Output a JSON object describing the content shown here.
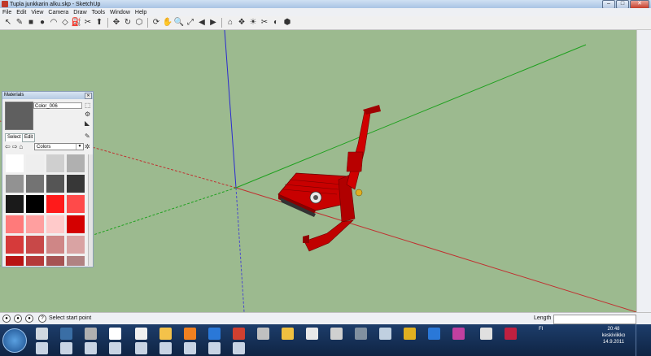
{
  "window": {
    "title": "Tupla junkkarin alku.skp - SketchUp",
    "minimize": "–",
    "maximize": "□",
    "close": "✕"
  },
  "menu": [
    "File",
    "Edit",
    "View",
    "Camera",
    "Draw",
    "Tools",
    "Window",
    "Help"
  ],
  "toolbar": {
    "icons": [
      "select-arrow-icon",
      "pencil-icon",
      "rectangle-icon",
      "circle-icon",
      "arc-icon",
      "eraser-icon",
      "paint-bucket-icon",
      "tape-measure-icon",
      "push-pull-icon",
      "move-icon",
      "rotate-icon",
      "offset-icon",
      "orbit-icon",
      "pan-icon",
      "zoom-icon",
      "zoom-extents-icon",
      "previous-view-icon",
      "next-view-icon",
      "warehouse-icon",
      "component-icon",
      "shadow-icon",
      "section-icon",
      "style-icon",
      "extension-icon"
    ],
    "glyphs": [
      "↖",
      "✎",
      "■",
      "●",
      "◠",
      "◇",
      "⛽",
      "✂",
      "⬆",
      "✥",
      "↻",
      "⬡",
      "⟳",
      "✋",
      "🔍",
      "⤢",
      "◀",
      "▶",
      "⌂",
      "❖",
      "☀",
      "✂",
      "◐",
      "⬢"
    ]
  },
  "materials": {
    "title": "Materials",
    "material_name": "Color_006",
    "tab_select": "Select",
    "tab_edit": "Edit",
    "library": "Colors",
    "current_color": "#5f5f5f",
    "swatches": [
      "#ffffff",
      "#eeeeee",
      "#cfcfcf",
      "#b0b0b0",
      "#929292",
      "#737373",
      "#555555",
      "#373737",
      "#1a1a1a",
      "#000000",
      "#ff1a1a",
      "#ff4a4a",
      "#ff7a7a",
      "#ff9f9f",
      "#ffcaca",
      "#d40000",
      "#d63a3a",
      "#c84848",
      "#cf8686",
      "#d9a3a3",
      "#b81414",
      "#b43a3a",
      "#a65353",
      "#b08282"
    ]
  },
  "status": {
    "text": "Select start point",
    "length_label": "Length",
    "length_value": ""
  },
  "taskbar": {
    "lang": "FI",
    "time": "20:48",
    "day": "keskiviikko",
    "date": "14.9.2011"
  }
}
